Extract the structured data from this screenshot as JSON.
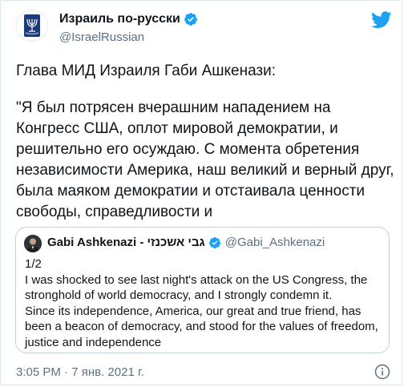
{
  "tweet": {
    "author": {
      "display_name": "Израиль по-русски",
      "handle": "@IsraelRussian",
      "verified": true,
      "avatar_icon": "israel-emblem-menorah"
    },
    "intro": "Глава МИД Израиля Габи Ашкенази:",
    "quote_lines": [
      "\"Я был потрясен вчерашним нападением на",
      "Конгресс США, оплот мировой демократии, и",
      "решительно его осуждаю. С момента обретения",
      "независимости Америка, наш великий и верный друг,",
      "была маяком демократии и отстаивала ценности",
      "свободы, справедливости и"
    ],
    "timestamp": "3:05 PM · 7 янв. 2021 г.",
    "brand_icon": "twitter-bird-icon",
    "info_icon": "info-icon"
  },
  "quoted_tweet": {
    "display_name": "Gabi Ashkenazi - גבי אשכנזי",
    "handle": "@Gabi_Ashkenazi",
    "verified": true,
    "body_lines": [
      "1/2",
      "I was shocked to see last night's attack on the US Congress, the",
      "stronghold of world democracy, and I strongly condemn it.",
      "Since its independence, America, our great and true friend, has",
      "been a beacon of democracy, and stood for the values of freedom,",
      "justice and independence"
    ]
  },
  "colors": {
    "text": "#0f1419",
    "secondary": "#5b7083",
    "twitter_blue": "#1da1f2",
    "border": "#e1e8ed",
    "emblem_blue": "#1a3a78"
  }
}
